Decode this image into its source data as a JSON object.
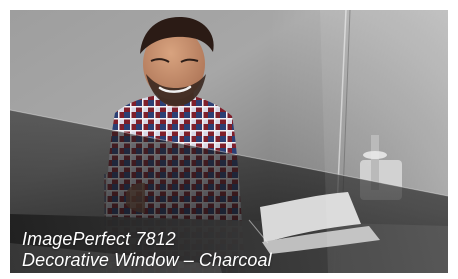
{
  "product": {
    "model_line": "ImagePerfect 7812",
    "description": "Decorative Window – Charcoal"
  }
}
